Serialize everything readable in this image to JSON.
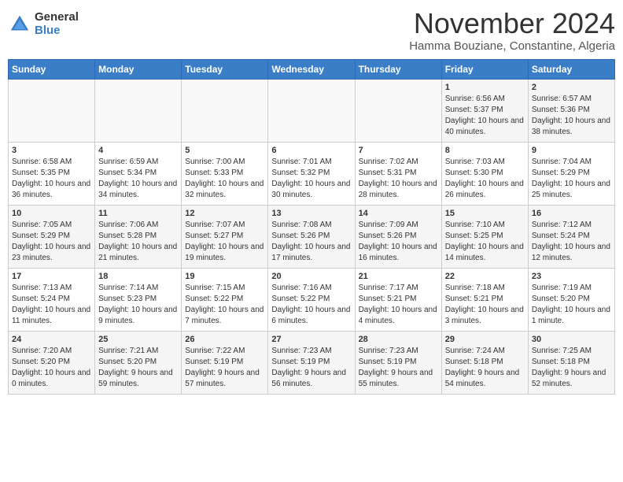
{
  "header": {
    "logo_general": "General",
    "logo_blue": "Blue",
    "month": "November 2024",
    "location": "Hamma Bouziane, Constantine, Algeria"
  },
  "weekdays": [
    "Sunday",
    "Monday",
    "Tuesday",
    "Wednesday",
    "Thursday",
    "Friday",
    "Saturday"
  ],
  "weeks": [
    [
      {
        "day": "",
        "info": ""
      },
      {
        "day": "",
        "info": ""
      },
      {
        "day": "",
        "info": ""
      },
      {
        "day": "",
        "info": ""
      },
      {
        "day": "",
        "info": ""
      },
      {
        "day": "1",
        "info": "Sunrise: 6:56 AM\nSunset: 5:37 PM\nDaylight: 10 hours and 40 minutes."
      },
      {
        "day": "2",
        "info": "Sunrise: 6:57 AM\nSunset: 5:36 PM\nDaylight: 10 hours and 38 minutes."
      }
    ],
    [
      {
        "day": "3",
        "info": "Sunrise: 6:58 AM\nSunset: 5:35 PM\nDaylight: 10 hours and 36 minutes."
      },
      {
        "day": "4",
        "info": "Sunrise: 6:59 AM\nSunset: 5:34 PM\nDaylight: 10 hours and 34 minutes."
      },
      {
        "day": "5",
        "info": "Sunrise: 7:00 AM\nSunset: 5:33 PM\nDaylight: 10 hours and 32 minutes."
      },
      {
        "day": "6",
        "info": "Sunrise: 7:01 AM\nSunset: 5:32 PM\nDaylight: 10 hours and 30 minutes."
      },
      {
        "day": "7",
        "info": "Sunrise: 7:02 AM\nSunset: 5:31 PM\nDaylight: 10 hours and 28 minutes."
      },
      {
        "day": "8",
        "info": "Sunrise: 7:03 AM\nSunset: 5:30 PM\nDaylight: 10 hours and 26 minutes."
      },
      {
        "day": "9",
        "info": "Sunrise: 7:04 AM\nSunset: 5:29 PM\nDaylight: 10 hours and 25 minutes."
      }
    ],
    [
      {
        "day": "10",
        "info": "Sunrise: 7:05 AM\nSunset: 5:29 PM\nDaylight: 10 hours and 23 minutes."
      },
      {
        "day": "11",
        "info": "Sunrise: 7:06 AM\nSunset: 5:28 PM\nDaylight: 10 hours and 21 minutes."
      },
      {
        "day": "12",
        "info": "Sunrise: 7:07 AM\nSunset: 5:27 PM\nDaylight: 10 hours and 19 minutes."
      },
      {
        "day": "13",
        "info": "Sunrise: 7:08 AM\nSunset: 5:26 PM\nDaylight: 10 hours and 17 minutes."
      },
      {
        "day": "14",
        "info": "Sunrise: 7:09 AM\nSunset: 5:26 PM\nDaylight: 10 hours and 16 minutes."
      },
      {
        "day": "15",
        "info": "Sunrise: 7:10 AM\nSunset: 5:25 PM\nDaylight: 10 hours and 14 minutes."
      },
      {
        "day": "16",
        "info": "Sunrise: 7:12 AM\nSunset: 5:24 PM\nDaylight: 10 hours and 12 minutes."
      }
    ],
    [
      {
        "day": "17",
        "info": "Sunrise: 7:13 AM\nSunset: 5:24 PM\nDaylight: 10 hours and 11 minutes."
      },
      {
        "day": "18",
        "info": "Sunrise: 7:14 AM\nSunset: 5:23 PM\nDaylight: 10 hours and 9 minutes."
      },
      {
        "day": "19",
        "info": "Sunrise: 7:15 AM\nSunset: 5:22 PM\nDaylight: 10 hours and 7 minutes."
      },
      {
        "day": "20",
        "info": "Sunrise: 7:16 AM\nSunset: 5:22 PM\nDaylight: 10 hours and 6 minutes."
      },
      {
        "day": "21",
        "info": "Sunrise: 7:17 AM\nSunset: 5:21 PM\nDaylight: 10 hours and 4 minutes."
      },
      {
        "day": "22",
        "info": "Sunrise: 7:18 AM\nSunset: 5:21 PM\nDaylight: 10 hours and 3 minutes."
      },
      {
        "day": "23",
        "info": "Sunrise: 7:19 AM\nSunset: 5:20 PM\nDaylight: 10 hours and 1 minute."
      }
    ],
    [
      {
        "day": "24",
        "info": "Sunrise: 7:20 AM\nSunset: 5:20 PM\nDaylight: 10 hours and 0 minutes."
      },
      {
        "day": "25",
        "info": "Sunrise: 7:21 AM\nSunset: 5:20 PM\nDaylight: 9 hours and 59 minutes."
      },
      {
        "day": "26",
        "info": "Sunrise: 7:22 AM\nSunset: 5:19 PM\nDaylight: 9 hours and 57 minutes."
      },
      {
        "day": "27",
        "info": "Sunrise: 7:23 AM\nSunset: 5:19 PM\nDaylight: 9 hours and 56 minutes."
      },
      {
        "day": "28",
        "info": "Sunrise: 7:23 AM\nSunset: 5:19 PM\nDaylight: 9 hours and 55 minutes."
      },
      {
        "day": "29",
        "info": "Sunrise: 7:24 AM\nSunset: 5:18 PM\nDaylight: 9 hours and 54 minutes."
      },
      {
        "day": "30",
        "info": "Sunrise: 7:25 AM\nSunset: 5:18 PM\nDaylight: 9 hours and 52 minutes."
      }
    ]
  ]
}
